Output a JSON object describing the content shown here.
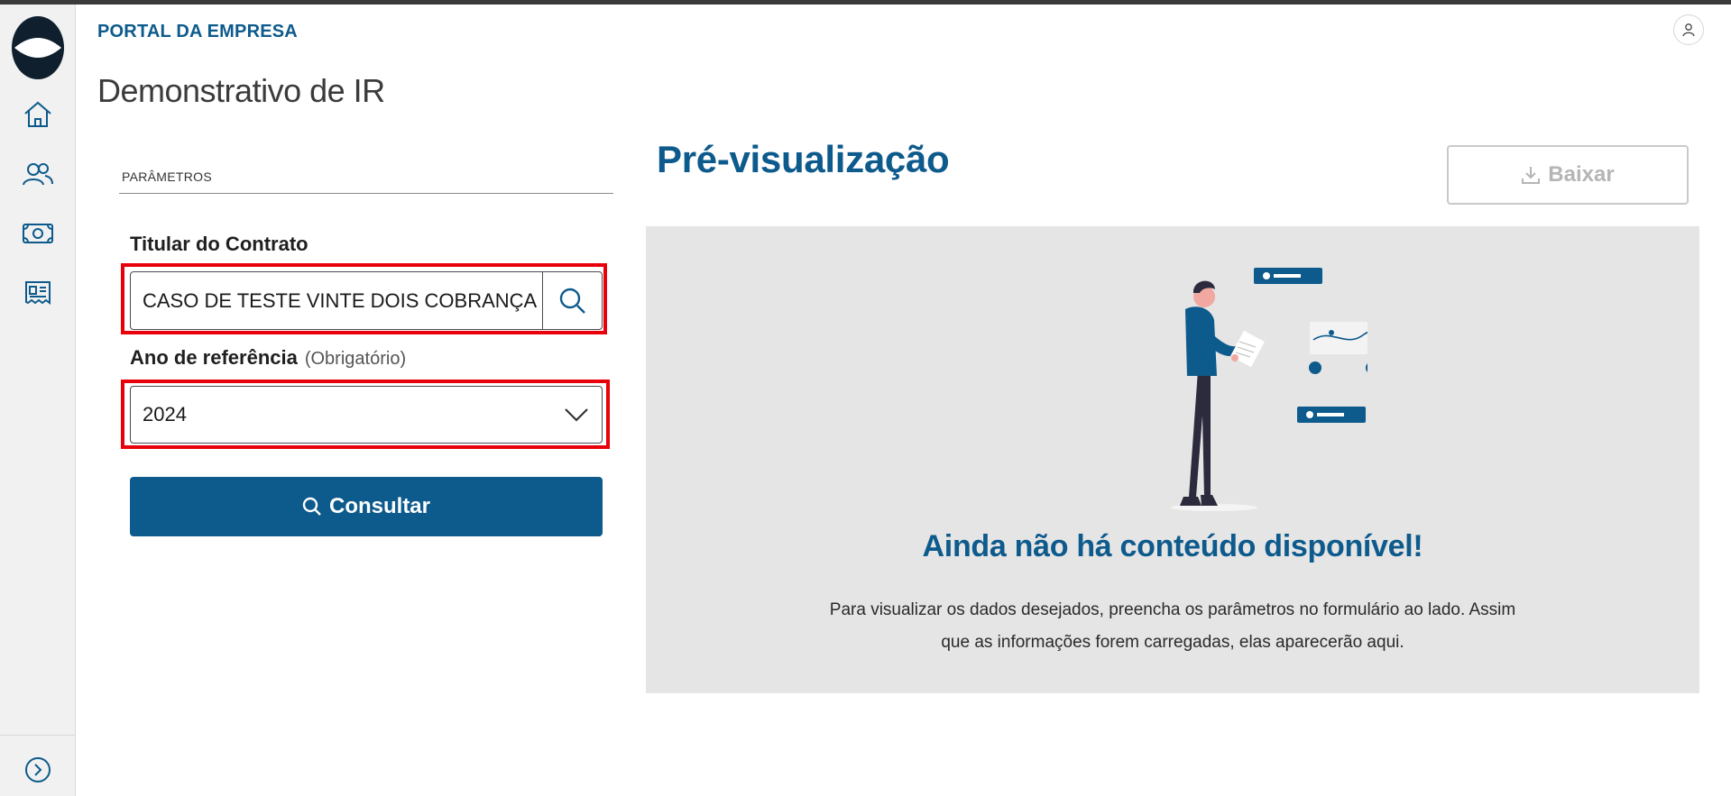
{
  "header": {
    "brand": "PORTAL DA EMPRESA",
    "page_title": "Demonstrativo de IR"
  },
  "sidebar": {
    "items": [
      {
        "icon": "home-icon"
      },
      {
        "icon": "users-icon"
      },
      {
        "icon": "money-icon"
      },
      {
        "icon": "statement-icon"
      }
    ],
    "expand_icon": "chevron-right-circle-icon"
  },
  "form": {
    "section_label": "PARÂMETROS",
    "holder_label": "Titular do Contrato",
    "holder_value": "CASO DE TESTE VINTE DOIS COBRANÇA",
    "year_label": "Ano de referência",
    "year_hint": "(Obrigatório)",
    "year_value": "2024",
    "consult_label": "Consultar"
  },
  "preview": {
    "title": "Pré-visualização",
    "download_label": "Baixar",
    "empty_title": "Ainda não há conteúdo disponível!",
    "empty_desc": "Para visualizar os dados desejados, preencha os parâmetros no formulário ao lado. Assim que as informações forem carregadas, elas aparecerão aqui."
  },
  "colors": {
    "primary": "#0d5a8c",
    "highlight": "#e8000b",
    "preview_bg": "#e5e5e5"
  }
}
